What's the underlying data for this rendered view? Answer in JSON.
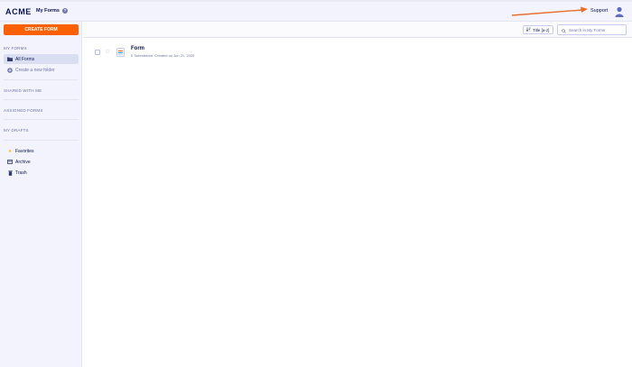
{
  "header": {
    "logo": "ACME",
    "title": "My Forms",
    "help_icon": "question-circle-icon",
    "support_label": "Support",
    "avatar_icon": "user-avatar-icon",
    "arrow_color": "#e8702a"
  },
  "sidebar": {
    "create_button": "CREATE FORM",
    "my_forms_label": "MY FORMS",
    "items": [
      {
        "label": "All Forms",
        "icon": "folder-icon",
        "active": true
      },
      {
        "label": "Create a new folder",
        "icon": "plus-circle-icon"
      }
    ],
    "shared_label": "SHARED WITH ME",
    "assigned_label": "ASSIGNED FORMS",
    "drafts_label": "MY DRAFTS",
    "bottom_items": [
      {
        "label": "Favorites",
        "icon": "star-icon"
      },
      {
        "label": "Archive",
        "icon": "archive-icon"
      },
      {
        "label": "Trash",
        "icon": "trash-icon"
      }
    ]
  },
  "toolbar": {
    "sort_label": "Title [a-z]",
    "search_placeholder": "Search in My Forms"
  },
  "forms": [
    {
      "title": "Form",
      "meta": "0 Submission. Created on Jun 21, 2020"
    }
  ],
  "colors": {
    "accent": "#ff6100",
    "brand": "#0a1551",
    "sidebar_bg": "#f3f3fe"
  }
}
